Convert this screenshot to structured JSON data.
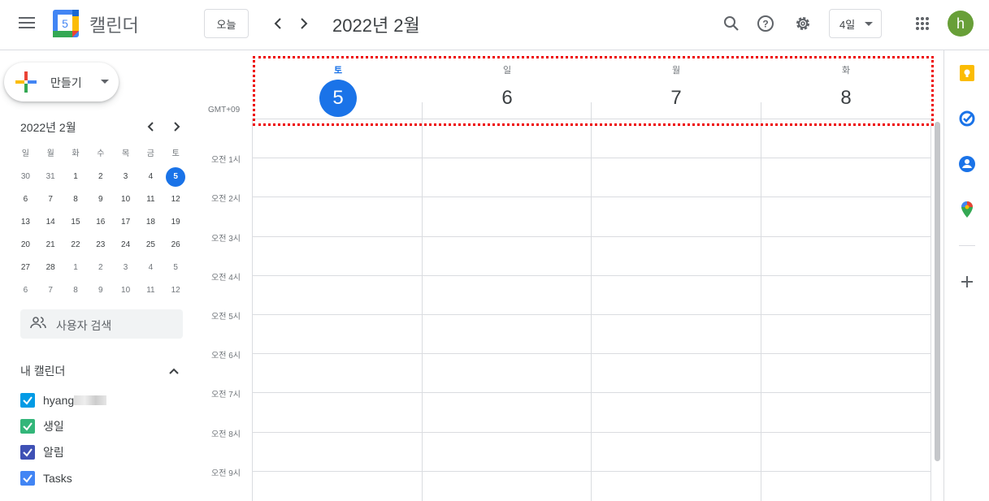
{
  "header": {
    "app_title": "캘린더",
    "logo_day": "5",
    "today_label": "오늘",
    "month_title": "2022년 2월",
    "view_label": "4일",
    "avatar_letter": "h",
    "brand_color": "#1a73e8"
  },
  "create": {
    "label": "만들기"
  },
  "mini_calendar": {
    "title": "2022년 2월",
    "weekdays": [
      "일",
      "월",
      "화",
      "수",
      "목",
      "금",
      "토"
    ],
    "weeks": [
      [
        "30",
        "31",
        "1",
        "2",
        "3",
        "4",
        "5"
      ],
      [
        "6",
        "7",
        "8",
        "9",
        "10",
        "11",
        "12"
      ],
      [
        "13",
        "14",
        "15",
        "16",
        "17",
        "18",
        "19"
      ],
      [
        "20",
        "21",
        "22",
        "23",
        "24",
        "25",
        "26"
      ],
      [
        "27",
        "28",
        "1",
        "2",
        "3",
        "4",
        "5"
      ],
      [
        "6",
        "7",
        "8",
        "9",
        "10",
        "11",
        "12"
      ]
    ],
    "today": "5"
  },
  "people_search": {
    "placeholder": "사용자 검색"
  },
  "my_calendars": {
    "title": "내 캘린더",
    "items": [
      {
        "label": "hyang",
        "color": "#039be5"
      },
      {
        "label": "생일",
        "color": "#33b679"
      },
      {
        "label": "알림",
        "color": "#3f51b5"
      },
      {
        "label": "Tasks",
        "color": "#4285f4"
      }
    ]
  },
  "week_view": {
    "timezone": "GMT+09",
    "days": [
      {
        "dow": "토",
        "num": "5",
        "today": true
      },
      {
        "dow": "일",
        "num": "6",
        "today": false
      },
      {
        "dow": "월",
        "num": "7",
        "today": false
      },
      {
        "dow": "화",
        "num": "8",
        "today": false
      }
    ],
    "hours": [
      "오전 1시",
      "오전 2시",
      "오전 3시",
      "오전 4시",
      "오전 5시",
      "오전 6시",
      "오전 7시",
      "오전 8시",
      "오전 9시"
    ]
  },
  "side_icons": [
    "keep-icon",
    "tasks-icon",
    "contacts-icon",
    "maps-icon",
    "add-icon"
  ]
}
